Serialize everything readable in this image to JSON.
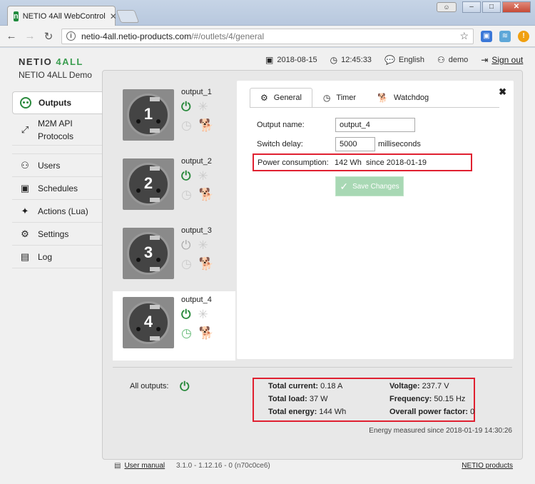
{
  "browser": {
    "tab_title": "NETIO 4All WebControl",
    "favicon_letter": "n",
    "url_host": "netio-4all.netio-products.com",
    "url_path": "/#/outlets/4/general"
  },
  "header": {
    "logo_text": "NETIO",
    "logo_accent": "4ALL",
    "device_name": "NETIO 4ALL Demo",
    "date": "2018-08-15",
    "time": "12:45:33",
    "language": "English",
    "user": "demo",
    "signout": "Sign out"
  },
  "sidebar": {
    "items": [
      {
        "label": "Outputs",
        "icon": "outputs-icon"
      },
      {
        "label": "M2M API Protocols",
        "icon": "m2m-icon"
      },
      {
        "label": "Users",
        "icon": "user-icon"
      },
      {
        "label": "Schedules",
        "icon": "calendar-icon"
      },
      {
        "label": "Actions (Lua)",
        "icon": "wand-icon"
      },
      {
        "label": "Settings",
        "icon": "gear-icon"
      },
      {
        "label": "Log",
        "icon": "document-icon"
      }
    ],
    "m2m_line1": "M2M API",
    "m2m_line2": "Protocols"
  },
  "outputs": [
    {
      "name": "output_1",
      "number": "1",
      "state": "on"
    },
    {
      "name": "output_2",
      "number": "2",
      "state": "on"
    },
    {
      "name": "output_3",
      "number": "3",
      "state": "off"
    },
    {
      "name": "output_4",
      "number": "4",
      "state": "on"
    }
  ],
  "detail": {
    "tabs": [
      "General",
      "Timer",
      "Watchdog"
    ],
    "output_name_label": "Output name:",
    "output_name_value": "output_4",
    "switch_delay_label": "Switch delay:",
    "switch_delay_value": "5000",
    "switch_delay_unit": "milliseconds",
    "power_label": "Power consumption:",
    "power_value": "142 Wh",
    "power_since": "since 2018-01-19",
    "save_label": "Save Changes"
  },
  "summary": {
    "all_outputs_label": "All outputs:",
    "total_current_label": "Total current:",
    "total_current": "0.18 A",
    "voltage_label": "Voltage:",
    "voltage": "237.7 V",
    "total_load_label": "Total load:",
    "total_load": "37 W",
    "frequency_label": "Frequency:",
    "frequency": "50.15 Hz",
    "total_energy_label": "Total energy:",
    "total_energy": "144 Wh",
    "power_factor_label": "Overall power factor:",
    "power_factor": "0",
    "measured_since": "Energy measured since 2018-01-19 14:30:26"
  },
  "footer": {
    "manual": "User manual",
    "version": "3.1.0 - 1.12.16 - 0 (n70c0ce6)",
    "netio_products": "NETIO products"
  },
  "colors": {
    "accent_green": "#2a8a3d",
    "highlight_red": "#e02030"
  }
}
